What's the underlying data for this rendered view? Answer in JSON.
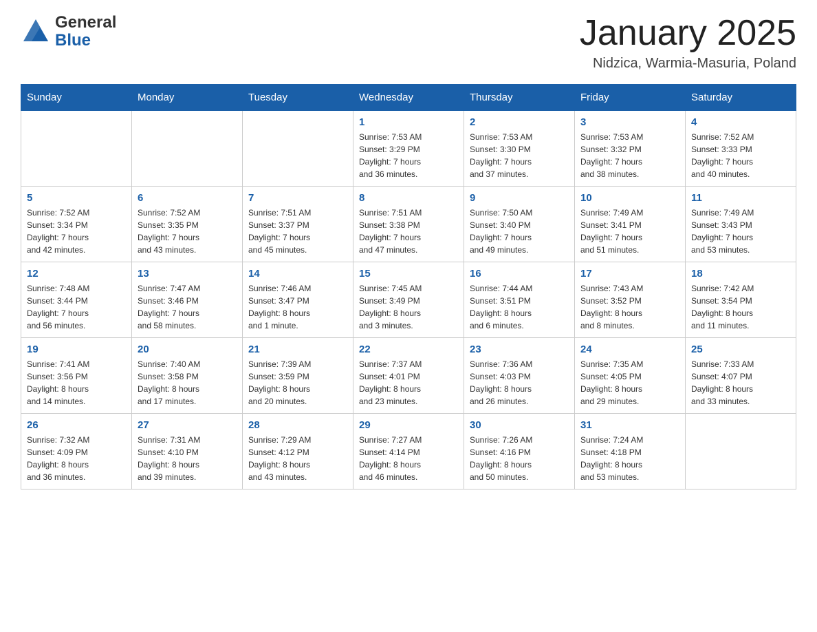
{
  "header": {
    "logo_general": "General",
    "logo_blue": "Blue",
    "title": "January 2025",
    "subtitle": "Nidzica, Warmia-Masuria, Poland"
  },
  "calendar": {
    "days_of_week": [
      "Sunday",
      "Monday",
      "Tuesday",
      "Wednesday",
      "Thursday",
      "Friday",
      "Saturday"
    ],
    "weeks": [
      {
        "days": [
          {
            "number": "",
            "info": ""
          },
          {
            "number": "",
            "info": ""
          },
          {
            "number": "",
            "info": ""
          },
          {
            "number": "1",
            "info": "Sunrise: 7:53 AM\nSunset: 3:29 PM\nDaylight: 7 hours\nand 36 minutes."
          },
          {
            "number": "2",
            "info": "Sunrise: 7:53 AM\nSunset: 3:30 PM\nDaylight: 7 hours\nand 37 minutes."
          },
          {
            "number": "3",
            "info": "Sunrise: 7:53 AM\nSunset: 3:32 PM\nDaylight: 7 hours\nand 38 minutes."
          },
          {
            "number": "4",
            "info": "Sunrise: 7:52 AM\nSunset: 3:33 PM\nDaylight: 7 hours\nand 40 minutes."
          }
        ]
      },
      {
        "days": [
          {
            "number": "5",
            "info": "Sunrise: 7:52 AM\nSunset: 3:34 PM\nDaylight: 7 hours\nand 42 minutes."
          },
          {
            "number": "6",
            "info": "Sunrise: 7:52 AM\nSunset: 3:35 PM\nDaylight: 7 hours\nand 43 minutes."
          },
          {
            "number": "7",
            "info": "Sunrise: 7:51 AM\nSunset: 3:37 PM\nDaylight: 7 hours\nand 45 minutes."
          },
          {
            "number": "8",
            "info": "Sunrise: 7:51 AM\nSunset: 3:38 PM\nDaylight: 7 hours\nand 47 minutes."
          },
          {
            "number": "9",
            "info": "Sunrise: 7:50 AM\nSunset: 3:40 PM\nDaylight: 7 hours\nand 49 minutes."
          },
          {
            "number": "10",
            "info": "Sunrise: 7:49 AM\nSunset: 3:41 PM\nDaylight: 7 hours\nand 51 minutes."
          },
          {
            "number": "11",
            "info": "Sunrise: 7:49 AM\nSunset: 3:43 PM\nDaylight: 7 hours\nand 53 minutes."
          }
        ]
      },
      {
        "days": [
          {
            "number": "12",
            "info": "Sunrise: 7:48 AM\nSunset: 3:44 PM\nDaylight: 7 hours\nand 56 minutes."
          },
          {
            "number": "13",
            "info": "Sunrise: 7:47 AM\nSunset: 3:46 PM\nDaylight: 7 hours\nand 58 minutes."
          },
          {
            "number": "14",
            "info": "Sunrise: 7:46 AM\nSunset: 3:47 PM\nDaylight: 8 hours\nand 1 minute."
          },
          {
            "number": "15",
            "info": "Sunrise: 7:45 AM\nSunset: 3:49 PM\nDaylight: 8 hours\nand 3 minutes."
          },
          {
            "number": "16",
            "info": "Sunrise: 7:44 AM\nSunset: 3:51 PM\nDaylight: 8 hours\nand 6 minutes."
          },
          {
            "number": "17",
            "info": "Sunrise: 7:43 AM\nSunset: 3:52 PM\nDaylight: 8 hours\nand 8 minutes."
          },
          {
            "number": "18",
            "info": "Sunrise: 7:42 AM\nSunset: 3:54 PM\nDaylight: 8 hours\nand 11 minutes."
          }
        ]
      },
      {
        "days": [
          {
            "number": "19",
            "info": "Sunrise: 7:41 AM\nSunset: 3:56 PM\nDaylight: 8 hours\nand 14 minutes."
          },
          {
            "number": "20",
            "info": "Sunrise: 7:40 AM\nSunset: 3:58 PM\nDaylight: 8 hours\nand 17 minutes."
          },
          {
            "number": "21",
            "info": "Sunrise: 7:39 AM\nSunset: 3:59 PM\nDaylight: 8 hours\nand 20 minutes."
          },
          {
            "number": "22",
            "info": "Sunrise: 7:37 AM\nSunset: 4:01 PM\nDaylight: 8 hours\nand 23 minutes."
          },
          {
            "number": "23",
            "info": "Sunrise: 7:36 AM\nSunset: 4:03 PM\nDaylight: 8 hours\nand 26 minutes."
          },
          {
            "number": "24",
            "info": "Sunrise: 7:35 AM\nSunset: 4:05 PM\nDaylight: 8 hours\nand 29 minutes."
          },
          {
            "number": "25",
            "info": "Sunrise: 7:33 AM\nSunset: 4:07 PM\nDaylight: 8 hours\nand 33 minutes."
          }
        ]
      },
      {
        "days": [
          {
            "number": "26",
            "info": "Sunrise: 7:32 AM\nSunset: 4:09 PM\nDaylight: 8 hours\nand 36 minutes."
          },
          {
            "number": "27",
            "info": "Sunrise: 7:31 AM\nSunset: 4:10 PM\nDaylight: 8 hours\nand 39 minutes."
          },
          {
            "number": "28",
            "info": "Sunrise: 7:29 AM\nSunset: 4:12 PM\nDaylight: 8 hours\nand 43 minutes."
          },
          {
            "number": "29",
            "info": "Sunrise: 7:27 AM\nSunset: 4:14 PM\nDaylight: 8 hours\nand 46 minutes."
          },
          {
            "number": "30",
            "info": "Sunrise: 7:26 AM\nSunset: 4:16 PM\nDaylight: 8 hours\nand 50 minutes."
          },
          {
            "number": "31",
            "info": "Sunrise: 7:24 AM\nSunset: 4:18 PM\nDaylight: 8 hours\nand 53 minutes."
          },
          {
            "number": "",
            "info": ""
          }
        ]
      }
    ]
  }
}
